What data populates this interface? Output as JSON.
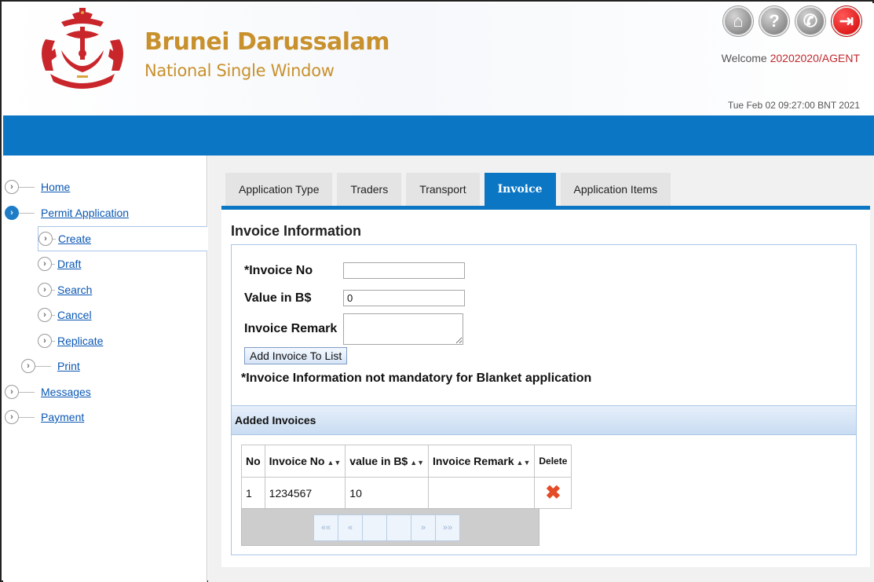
{
  "header": {
    "brand_title": "Brunei Darussalam",
    "brand_subtitle": "National Single Window",
    "welcome_prefix": "Welcome ",
    "welcome_user": "20202020/AGENT",
    "datetime": "Tue Feb 02 09:27:00 BNT 2021",
    "icons": [
      {
        "name": "home-icon",
        "glyph": "⌂"
      },
      {
        "name": "help-icon",
        "glyph": "?"
      },
      {
        "name": "phone-icon",
        "glyph": "✆"
      },
      {
        "name": "logout-icon",
        "glyph": "⇥"
      }
    ]
  },
  "sidebar": {
    "home": "Home",
    "permit_application": "Permit Application",
    "create": "Create",
    "draft": "Draft",
    "search": "Search",
    "cancel": "Cancel",
    "replicate": "Replicate",
    "print": "Print",
    "messages": "Messages",
    "payment": "Payment"
  },
  "tabs": {
    "application_type": "Application Type",
    "traders": "Traders",
    "transport": "Transport",
    "invoice": "Invoice",
    "application_items": "Application Items",
    "active": "Invoice"
  },
  "form": {
    "title": "Invoice Information",
    "invoice_no_label": "*Invoice No",
    "invoice_no_value": "",
    "value_label": "Value in B$",
    "value_value": "0",
    "remark_label": "Invoice Remark",
    "remark_value": "",
    "add_button": "Add Invoice To List",
    "note": "*Invoice Information not mandatory for Blanket application"
  },
  "added_invoices": {
    "title": "Added Invoices",
    "columns": {
      "no": "No",
      "invoice_no": "Invoice No",
      "value": "value in B$",
      "remark": "Invoice Remark",
      "delete": "Delete"
    },
    "rows": [
      {
        "no": "1",
        "invoice_no": "1234567",
        "value": "10",
        "remark": ""
      }
    ],
    "pager": {
      "first": "««",
      "prev": "«",
      "next": "»",
      "last": "»»"
    }
  },
  "colors": {
    "brand_gold": "#c8912e",
    "bar_blue": "#0b76c4",
    "link_blue": "#0a57b4",
    "user_red": "#c0282e",
    "delete_red": "#e34c26"
  }
}
